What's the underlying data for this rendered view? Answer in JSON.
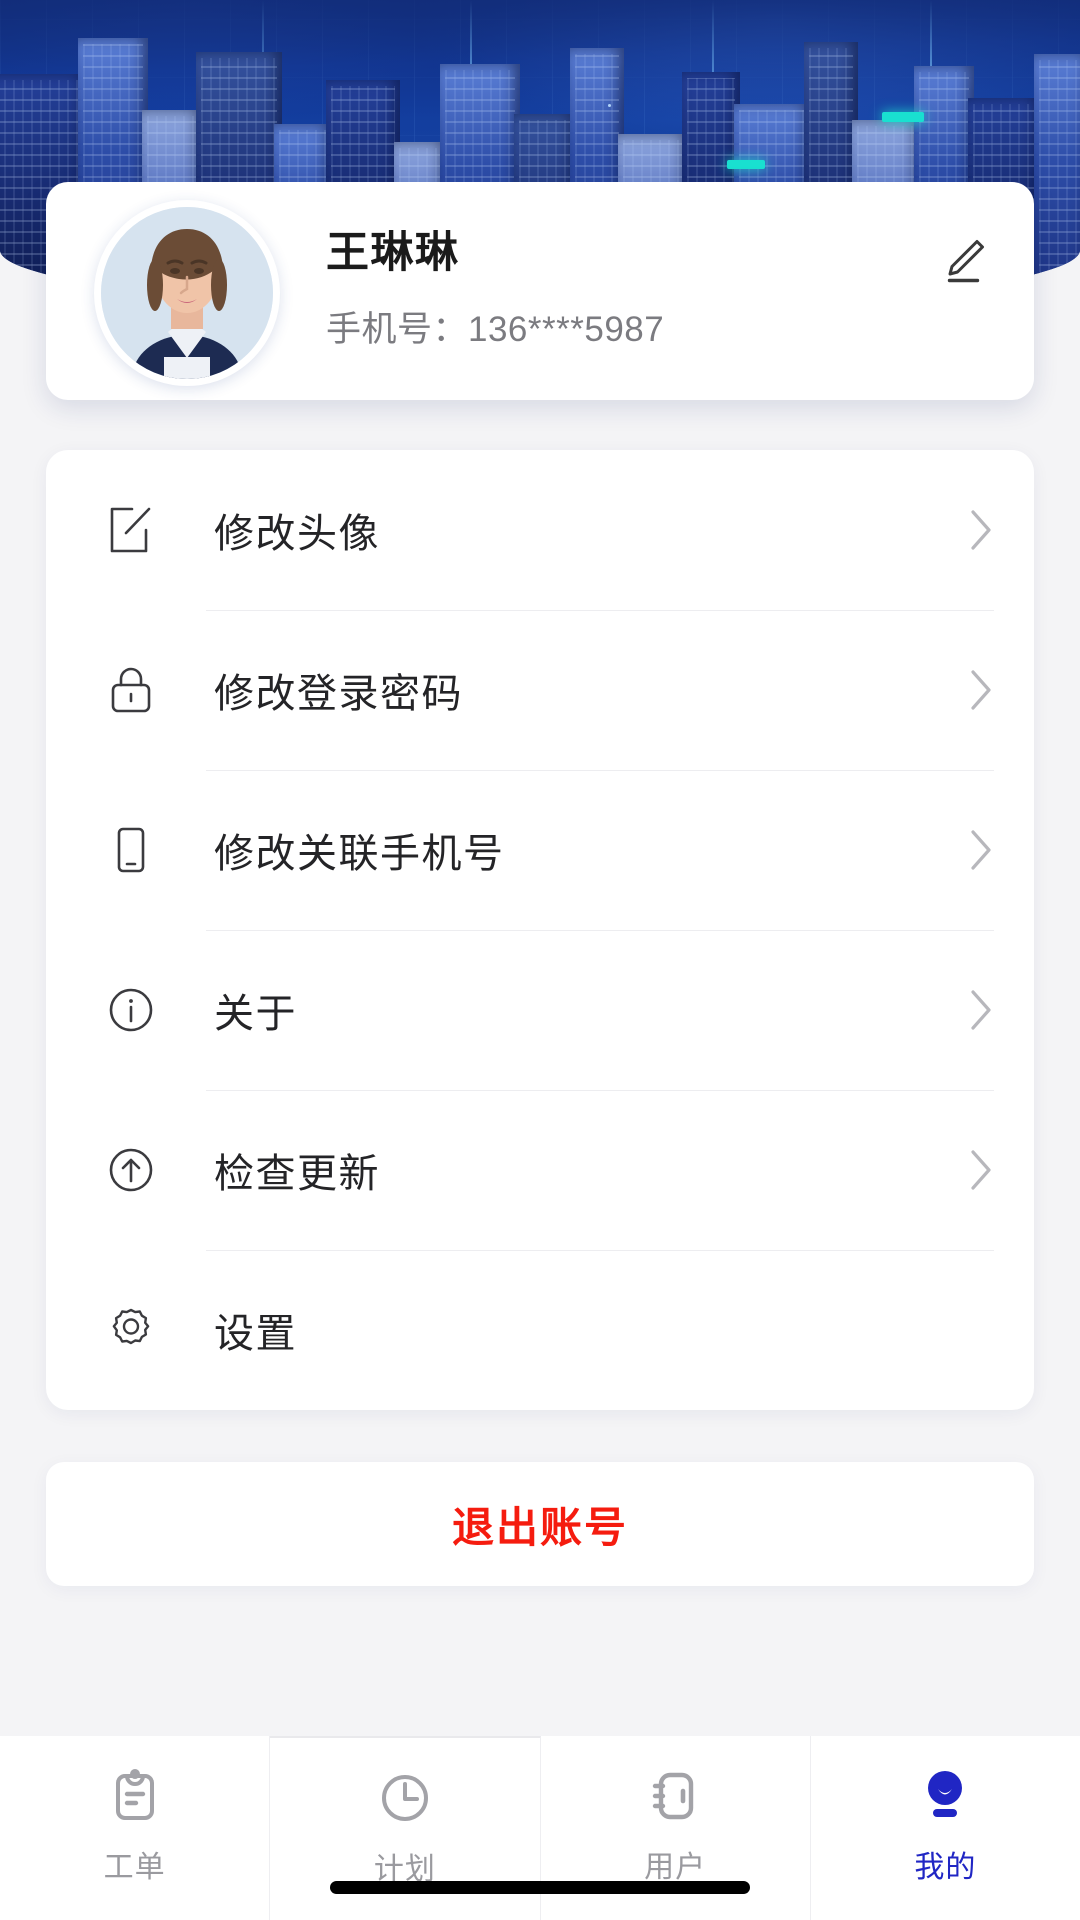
{
  "banner": {
    "alt": "city-skyline-banner"
  },
  "profile": {
    "name": "王琳琳",
    "phone": "手机号：136****5987",
    "edit_icon": "pencil-edit-icon",
    "avatar_alt": "user-avatar-portrait"
  },
  "menu": {
    "items": [
      {
        "label": "修改头像",
        "icon": "edit-square-icon",
        "chevron": "›",
        "has_chevron": true
      },
      {
        "label": "修改登录密码",
        "icon": "lock-icon",
        "chevron": "›",
        "has_chevron": true
      },
      {
        "label": "修改关联手机号",
        "icon": "mobile-phone-icon",
        "chevron": "›",
        "has_chevron": true
      },
      {
        "label": "关于",
        "icon": "info-circle-icon",
        "chevron": "›",
        "has_chevron": true
      },
      {
        "label": "检查更新",
        "icon": "arrow-up-circle-icon",
        "chevron": "›",
        "has_chevron": true
      },
      {
        "label": "设置",
        "icon": "gear-icon",
        "chevron": "",
        "has_chevron": false
      }
    ]
  },
  "logout": {
    "label": "退出账号",
    "color": "#f51c0f"
  },
  "tabbar": {
    "items": [
      {
        "label": "工单",
        "icon": "clipboard-icon",
        "active": false
      },
      {
        "label": "计划",
        "icon": "clock-icon",
        "active": false
      },
      {
        "label": "用户",
        "icon": "contacts-book-icon",
        "active": false
      },
      {
        "label": "我的",
        "icon": "person-icon",
        "active": true
      }
    ],
    "active_color": "#2026c4",
    "inactive_color": "#9a9a9f"
  },
  "system": {
    "home_indicator": "home-indicator-bar"
  }
}
